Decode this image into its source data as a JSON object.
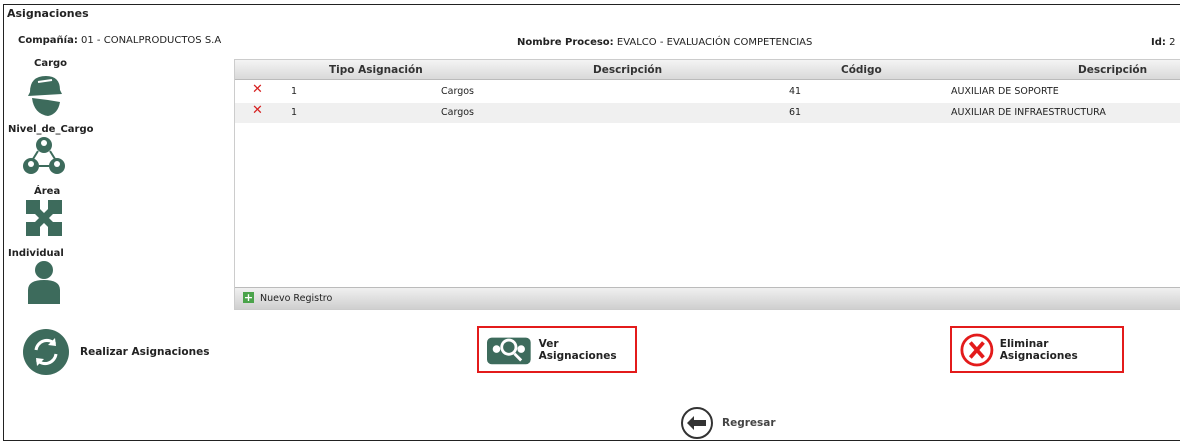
{
  "window": {
    "title": "Asignaciones"
  },
  "header": {
    "company_label": "Compañía:",
    "company_value": "01 - CONALPRODUCTOS S.A",
    "process_label": "Nombre Proceso:",
    "process_value": "EVALCO - EVALUACIÓN COMPETENCIAS",
    "id_label": "Id:",
    "id_value": "2"
  },
  "sidebar": {
    "items": [
      {
        "label": "Cargo",
        "icon": "worker-helmet-icon"
      },
      {
        "label": "Nivel_de_Cargo",
        "icon": "hierarchy-people-icon"
      },
      {
        "label": "Área",
        "icon": "puzzle-hands-icon"
      },
      {
        "label": "Individual",
        "icon": "person-icon"
      }
    ]
  },
  "grid": {
    "columns": [
      "Tipo Asignación",
      "Descripción",
      "Código",
      "Descripción"
    ],
    "rows": [
      {
        "tipo": "1",
        "descripcion": "Cargos",
        "codigo": "41",
        "descripcion2": "AUXILIAR DE SOPORTE"
      },
      {
        "tipo": "1",
        "descripcion": "Cargos",
        "codigo": "61",
        "descripcion2": "AUXILIAR DE INFRAESTRUCTURA"
      }
    ],
    "footer_label": "Nuevo Registro"
  },
  "actions": {
    "realizar": "Realizar Asignaciones",
    "ver": "Ver Asignaciones",
    "eliminar": "Eliminar Asignaciones",
    "regresar": "Regresar"
  },
  "colors": {
    "icon": "#3d6b5c",
    "highlight": "#e31b1b",
    "delete": "#d62020"
  }
}
